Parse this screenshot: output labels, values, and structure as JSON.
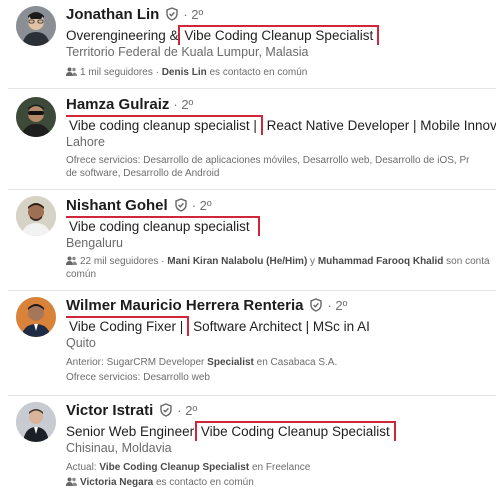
{
  "results": [
    {
      "name": "Jonathan Lin",
      "degree": "2º",
      "headline_pre": "Overengineering & ",
      "headline_hl": "Vibe Coding Cleanup Specialist",
      "location": "Territorio Federal de Kuala Lumpur, Malasia",
      "meta": {
        "followers": "1 mil seguidores",
        "contact_name": "Denis Lin",
        "contact_suffix": " es contacto en común"
      }
    },
    {
      "name": "Hamza Gulraiz",
      "degree": "2º",
      "headline_hl": "Vibe coding cleanup specialist |",
      "headline_post": " React Native Developer | Mobile Innovation Enthusiast",
      "location": "Lahore",
      "services_line1": "Ofrece servicios: Desarrollo de aplicaciones móviles, Desarrollo web, Desarrollo de iOS, Pr",
      "services_line2": "de software, Desarrollo de Android"
    },
    {
      "name": "Nishant Gohel",
      "degree": "2º",
      "headline_hl": "Vibe coding cleanup specialist",
      "location": "Bengaluru",
      "meta_line1_pre": "22 mil seguidores · ",
      "contact1": "Mani Kiran Nalabolu (He/Him)",
      "meta_and": " y ",
      "contact2": "Muhammad Farooq Khalid",
      "meta_line1_post": " son conta",
      "meta_line2": "común"
    },
    {
      "name": "Wilmer Mauricio Herrera Renteria",
      "degree": "2º",
      "headline_hl": "Vibe Coding Fixer |",
      "headline_post": " Software Architect | MSc in AI",
      "location": "Quito",
      "past_label": "Anterior: SugarCRM Developer ",
      "past_bold": "Specialist",
      "past_post": " en Casabaca S.A.",
      "services": "Ofrece servicios: Desarrollo web"
    },
    {
      "name": "Victor Istrati",
      "degree": "2º",
      "headline_pre": "Senior Web Engineer ",
      "headline_hl": "Vibe Coding Cleanup Specialist",
      "location": "Chisinau, Moldavia",
      "current_label": "Actual: ",
      "current_bold": "Vibe Coding Cleanup Specialist",
      "current_post": " en Freelance",
      "contact_name": "Victoria Negara",
      "contact_suffix": " es contacto en común"
    }
  ]
}
